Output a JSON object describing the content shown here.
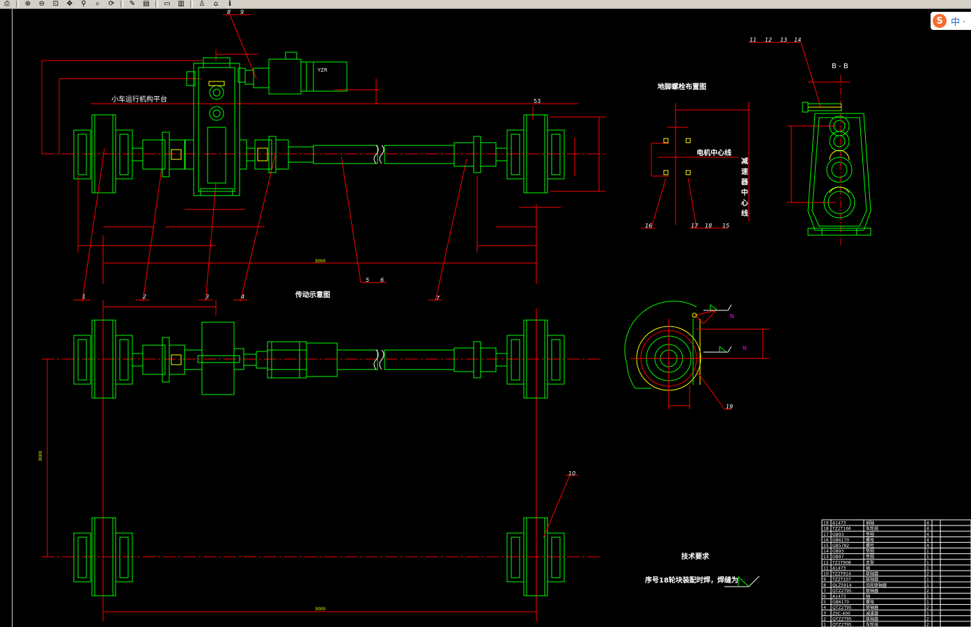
{
  "toolbar": {
    "buttons": [
      {
        "name": "print-icon",
        "glyph": "⎙"
      },
      {
        "name": "zoom-in-icon",
        "glyph": "⊕"
      },
      {
        "name": "zoom-out-icon",
        "glyph": "⊖"
      },
      {
        "name": "zoom-window-icon",
        "glyph": "⊡"
      },
      {
        "name": "pan-icon",
        "glyph": "✥"
      },
      {
        "name": "zoom-realtime-icon",
        "glyph": "⚲"
      },
      {
        "name": "zoom-extents-icon",
        "glyph": "⌕"
      },
      {
        "name": "redraw-icon",
        "glyph": "⟳"
      },
      {
        "name": "brush-icon",
        "glyph": "✎"
      },
      {
        "name": "layer-icon",
        "glyph": "▤"
      },
      {
        "name": "print-preview-icon",
        "glyph": "▭"
      },
      {
        "name": "properties-icon",
        "glyph": "▥"
      },
      {
        "name": "user-icon",
        "glyph": "♙"
      },
      {
        "name": "home-icon",
        "glyph": "⌂"
      },
      {
        "name": "info-icon",
        "glyph": "ℹ"
      }
    ]
  },
  "ime": {
    "logo": "S",
    "mode": "中 ·"
  },
  "labels": {
    "trolley_platform": "小车运行机构平台",
    "transmission_diagram": "传动示意图",
    "foot_bolt_layout": "地脚螺栓布置图",
    "motor_center_line": "电机中心线",
    "reducer_center_line": "减速器中心线",
    "section_bb": "B - B",
    "tech_requirements": "技术要求",
    "tech_note": "序号18轮块装配时焊，焊缝为",
    "motor_nameplate": "YZR"
  },
  "callouts": [
    "1",
    "2",
    "3",
    "4",
    "5",
    "6",
    "7",
    "8",
    "9",
    "10",
    "11",
    "12",
    "13",
    "14",
    "15",
    "16",
    "17",
    "18",
    "19"
  ],
  "dims": {
    "top_wheel_span": "3000",
    "bottom_wheel_span": "3000",
    "left_vertical": "3000",
    "d53": "53"
  },
  "parts_table": [
    [
      "19",
      "A1473",
      "销轴",
      "4"
    ],
    [
      "18",
      "TZ2T166",
      "车轮组",
      "4"
    ],
    [
      "17",
      "GB93",
      "垫圈",
      "4"
    ],
    [
      "16",
      "GB6170",
      "螺母",
      "4"
    ],
    [
      "15",
      "GB5782",
      "螺栓",
      "4"
    ],
    [
      "14",
      "GB93",
      "垫圈",
      "1"
    ],
    [
      "13",
      "GB97",
      "垫圈",
      "1"
    ],
    [
      "12",
      "TZ2T908",
      "支架",
      "1"
    ],
    [
      "11",
      "A1473",
      "销",
      "1"
    ],
    [
      "10",
      "TZ2T914",
      "联轴器",
      "2"
    ],
    [
      "9",
      "TZ2T107",
      "联轴器",
      "1"
    ],
    [
      "8",
      "QLZ5914",
      "齿轮联轴器",
      "1"
    ],
    [
      "7",
      "QTZ2T95",
      "联轴器",
      "2"
    ],
    [
      "6",
      "A1473",
      "轴",
      "1"
    ],
    [
      "5",
      "GB6170",
      "螺母",
      "1"
    ],
    [
      "4",
      "QTZ2T95",
      "联轴器",
      "2"
    ],
    [
      "3",
      "ZSC-400",
      "减速器",
      "1"
    ],
    [
      "2",
      "QTZ2T95",
      "联轴器",
      "2"
    ],
    [
      "1",
      "QTZ2T95",
      "车轮组",
      "2"
    ]
  ],
  "colors": {
    "green": "#00ff00",
    "red": "#ff0000",
    "white": "#ffffff",
    "yellow": "#ffff00",
    "magenta": "#ff00ff",
    "bg": "#000000"
  }
}
